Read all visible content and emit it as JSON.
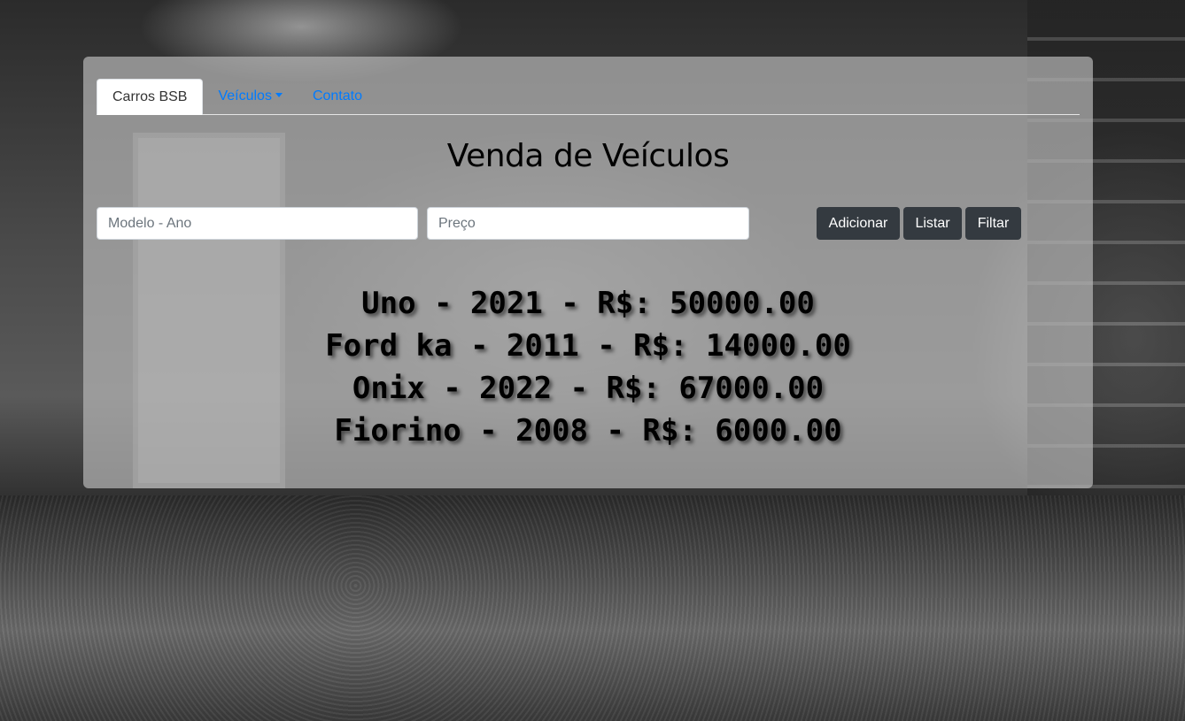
{
  "nav": {
    "brand": "Carros BSB",
    "dropdown": "Veículos",
    "contact": "Contato"
  },
  "title": "Venda de Veículos",
  "form": {
    "modelo_placeholder": "Modelo - Ano",
    "modelo_value": "",
    "preco_placeholder": "Preço",
    "preco_value": "",
    "add_label": "Adicionar",
    "list_label": "Listar",
    "filter_label": "Filtar"
  },
  "cars": [
    "Uno - 2021 - R$: 50000.00",
    "Ford ka - 2011 - R$: 14000.00",
    "Onix - 2022 - R$: 67000.00",
    "Fiorino - 2008 - R$: 6000.00"
  ],
  "colors": {
    "link": "#007bff",
    "button": "#343a40"
  }
}
